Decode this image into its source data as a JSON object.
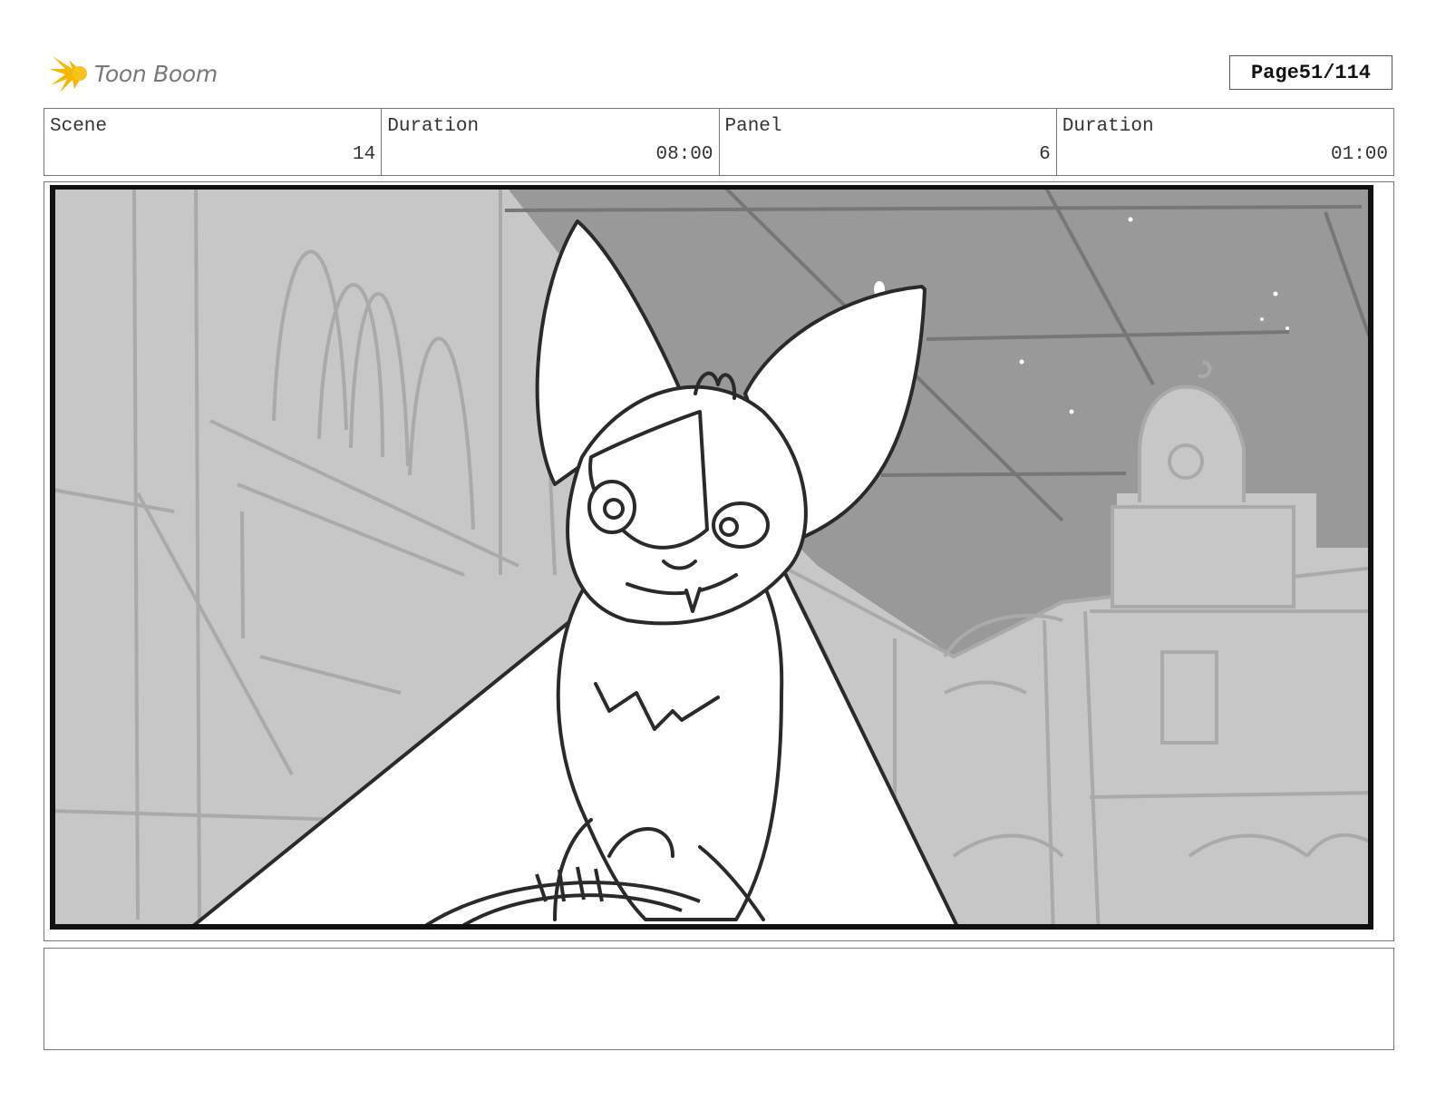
{
  "header": {
    "logo_text": "Toon Boom",
    "logo_color": "#f5b700",
    "page_label": "Page",
    "page_number": "51/114"
  },
  "info": {
    "scene_label": "Scene",
    "scene_value": "14",
    "scene_duration_label": "Duration",
    "scene_duration_value": "08:00",
    "panel_label": "Panel",
    "panel_value": "6",
    "panel_duration_label": "Duration",
    "panel_duration_value": "01:00"
  },
  "panel": {
    "image": "storyboard-sketch"
  },
  "notes": {
    "text": ""
  }
}
